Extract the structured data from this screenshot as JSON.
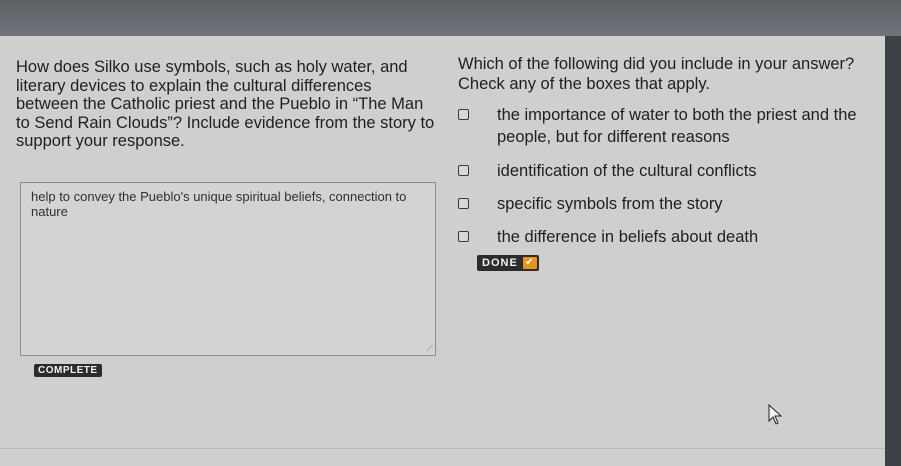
{
  "question": {
    "text": "How does Silko use symbols, such as holy water, and literary devices to explain the cultural differences between the Catholic priest and the Pueblo in “The Man to Send Rain Clouds”? Include evidence from the story to support your response."
  },
  "answer": {
    "text": "help to convey the Pueblo's unique spiritual beliefs, connection to nature"
  },
  "complete_label": "COMPLETE",
  "checklist": {
    "prompt": "Which of the following did you include in your answer? Check any of the boxes that apply.",
    "options": [
      {
        "label": "the importance of water to both the priest and the people, but for different reasons",
        "checked": false
      },
      {
        "label": "identification of the cultural conflicts",
        "checked": false
      },
      {
        "label": "specific symbols from the story",
        "checked": false
      },
      {
        "label": "the difference in beliefs about death",
        "checked": false
      }
    ],
    "done_label": "DONE"
  },
  "colors": {
    "accent": "#e8951f",
    "badge": "#2c2c2c",
    "panel": "#cfcfcd"
  },
  "icons": {
    "done_check": "checkmark-icon",
    "resize": "resize-grip-icon",
    "cursor": "mouse-pointer-icon"
  }
}
